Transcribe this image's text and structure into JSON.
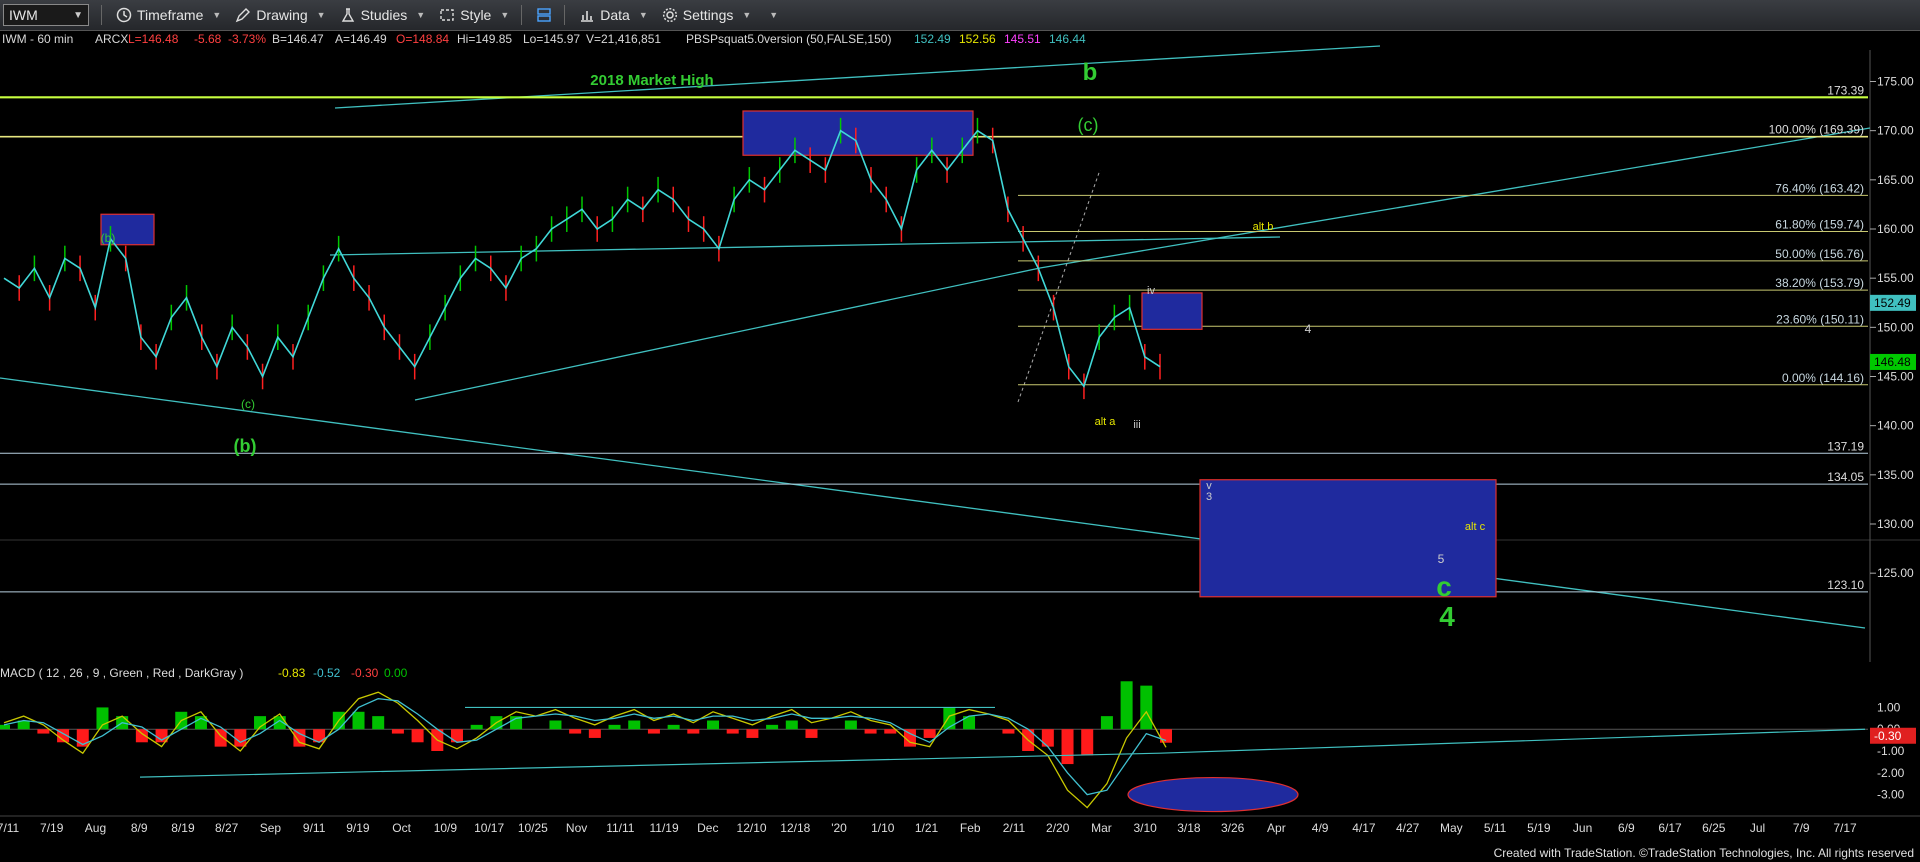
{
  "toolbar": {
    "symbol": "IWM",
    "items": [
      "Timeframe",
      "Drawing",
      "Studies",
      "Style",
      "Data",
      "Settings"
    ]
  },
  "header": {
    "title": "IWM - 60 min",
    "exchange": "ARCX",
    "last": "L=146.48",
    "change": "-5.68",
    "change_pct": "-3.73%",
    "bid": "B=146.47",
    "ask": "A=146.49",
    "open": "O=148.84",
    "high": "Hi=149.85",
    "low": "Lo=145.97",
    "volume": "V=21,416,851",
    "study": "PBSPsquat5.0version (50,FALSE,150)",
    "study_values": [
      "152.49",
      "152.56",
      "145.51",
      "146.44"
    ]
  },
  "colors": {
    "up": "#00c800",
    "down": "#ff2020",
    "band": "#40c0c0",
    "fib": "#c8c870",
    "green_label": "#33cc33",
    "yellow_label": "#e6e600",
    "price_box": "#1f2a9e",
    "macd_fast": "#c8c800",
    "macd_slow": "#40c0d0",
    "hist_pos": "#00c000",
    "hist_neg": "#ff1a1a"
  },
  "chart_data": [
    {
      "type": "line",
      "title": "IWM - 60 min",
      "ylim": [
        118,
        178
      ],
      "y_ticks": [
        "175.00",
        "170.00",
        "165.00",
        "160.00",
        "155.00",
        "150.00",
        "145.00",
        "140.00",
        "135.00",
        "130.00",
        "125.00"
      ],
      "x_ticks": [
        "7/11",
        "7/19",
        "Aug",
        "8/9",
        "8/19",
        "8/27",
        "Sep",
        "9/11",
        "9/19",
        "Oct",
        "10/9",
        "10/17",
        "10/25",
        "Nov",
        "11/11",
        "11/19",
        "Dec",
        "12/10",
        "12/18",
        "'20",
        "1/10",
        "1/21",
        "Feb",
        "2/11",
        "2/20",
        "Mar",
        "3/10",
        "3/18",
        "3/26",
        "Apr",
        "4/9",
        "4/17",
        "4/27",
        "May",
        "5/11",
        "5/19",
        "Jun",
        "6/9",
        "6/17",
        "6/25",
        "Jul",
        "7/9",
        "7/17"
      ],
      "series": [
        {
          "values": [
            155,
            154,
            156,
            153,
            157,
            156,
            152,
            159,
            157,
            149,
            147,
            151,
            153,
            149,
            146,
            150,
            148,
            145,
            149,
            147,
            151,
            155,
            158,
            155,
            153,
            150,
            148,
            146,
            149,
            152,
            155,
            157,
            156,
            154,
            157,
            158,
            160,
            161,
            162,
            160,
            161,
            163,
            162,
            164,
            163,
            161,
            160,
            158,
            163,
            165,
            164,
            166,
            168,
            167,
            166,
            170,
            169,
            165,
            163,
            160,
            166,
            168,
            166,
            168,
            170,
            169,
            162,
            159,
            156,
            152,
            146,
            144,
            149,
            151,
            152,
            147,
            146
          ]
        }
      ],
      "level_lines": [
        {
          "label": "173.39",
          "value": 173.39
        },
        {
          "label": "100.00% (169.39)",
          "value": 169.39
        },
        {
          "label": "76.40% (163.42)",
          "value": 163.42
        },
        {
          "label": "61.80% (159.74)",
          "value": 159.74
        },
        {
          "label": "50.00% (156.76)",
          "value": 156.76
        },
        {
          "label": "38.20% (153.79)",
          "value": 153.79
        },
        {
          "label": "23.60% (150.11)",
          "value": 150.11
        },
        {
          "label": "0.00% (144.16)",
          "value": 144.16
        },
        {
          "label": "137.19",
          "value": 137.19
        },
        {
          "label": "134.05",
          "value": 134.05
        },
        {
          "label": "123.10",
          "value": 123.1
        }
      ],
      "price_tags": [
        {
          "label": "152.49",
          "value": 152.49,
          "color": "#40c0c0"
        },
        {
          "label": "146.48",
          "value": 146.48,
          "color": "#00c800"
        }
      ],
      "annotations": [
        {
          "text": "2018 Market High",
          "color": "#33cc33"
        },
        {
          "text": "b",
          "color": "#33cc33"
        },
        {
          "text": "(c)",
          "color": "#33cc33"
        },
        {
          "text": "(b)",
          "color": "#33cc33"
        },
        {
          "text": "(c)",
          "color": "#33cc33"
        },
        {
          "text": "(b)",
          "color": "#33cc33"
        },
        {
          "text": "alt b",
          "color": "#e6e600"
        },
        {
          "text": "alt a",
          "color": "#e6e600"
        },
        {
          "text": "iv",
          "color": "#cccccc"
        },
        {
          "text": "iii",
          "color": "#cccccc"
        },
        {
          "text": "4",
          "color": "#cccccc"
        },
        {
          "text": "v",
          "color": "#cccccc"
        },
        {
          "text": "3",
          "color": "#cccccc"
        },
        {
          "text": "alt c",
          "color": "#e6e600"
        },
        {
          "text": "5",
          "color": "#cccccc"
        },
        {
          "text": "c",
          "color": "#33cc33"
        },
        {
          "text": "4",
          "color": "#33cc33"
        }
      ]
    },
    {
      "type": "line",
      "title": "MACD ( 12 , 26 , 9 , Green , Red , DarkGray )",
      "legend_values": [
        "-0.83",
        "-0.52",
        "-0.30",
        "0.00"
      ],
      "ylim": [
        -3.8,
        1.8
      ],
      "y_ticks": [
        "1.00",
        "0.00",
        "-1.00",
        "-2.00",
        "-3.00"
      ],
      "price_tag": {
        "label": "-0.30",
        "value": -0.3
      },
      "series": [
        {
          "name": "MACD",
          "values": [
            0.3,
            0.6,
            0.2,
            -0.5,
            -1.1,
            0.2,
            0.6,
            -0.2,
            -0.8,
            0.4,
            0.8,
            -0.3,
            -1.0,
            0.1,
            0.7,
            -0.6,
            -0.9,
            0.4,
            1.4,
            1.7,
            1.2,
            0.4,
            -0.5,
            -0.9,
            -0.4,
            0.3,
            0.8,
            0.6,
            0.9,
            0.5,
            0.2,
            0.6,
            0.9,
            0.4,
            0.7,
            0.3,
            0.8,
            0.5,
            0.2,
            0.6,
            0.9,
            0.3,
            0.5,
            0.8,
            0.4,
            0.2,
            -0.6,
            -0.8,
            0.6,
            0.9,
            0.7,
            0.4,
            -0.5,
            -1.2,
            -2.8,
            -3.6,
            -2.5,
            -0.4,
            0.8,
            -0.83
          ]
        },
        {
          "name": "Signal",
          "values": [
            0.2,
            0.4,
            0.3,
            -0.2,
            -0.7,
            -0.3,
            0.3,
            0.1,
            -0.5,
            0.0,
            0.5,
            0.1,
            -0.6,
            -0.2,
            0.4,
            -0.2,
            -0.6,
            0.0,
            1.0,
            1.4,
            1.3,
            0.7,
            0.0,
            -0.6,
            -0.5,
            0.0,
            0.5,
            0.6,
            0.7,
            0.6,
            0.4,
            0.5,
            0.7,
            0.5,
            0.6,
            0.4,
            0.6,
            0.6,
            0.4,
            0.5,
            0.7,
            0.5,
            0.5,
            0.6,
            0.5,
            0.3,
            -0.2,
            -0.6,
            0.1,
            0.6,
            0.7,
            0.5,
            0.0,
            -0.8,
            -2.0,
            -3.0,
            -2.8,
            -1.5,
            -0.2,
            -0.52
          ]
        }
      ]
    }
  ]
}
